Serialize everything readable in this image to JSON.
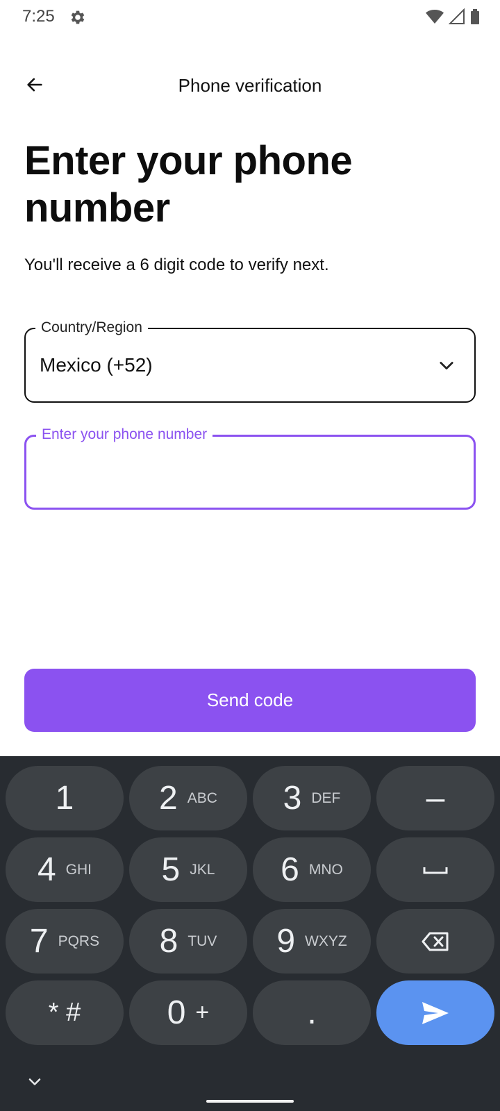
{
  "status_bar": {
    "time": "7:25"
  },
  "app_bar": {
    "title": "Phone verification"
  },
  "content": {
    "heading": "Enter your phone number",
    "subtitle": "You'll receive a 6 digit code to verify next."
  },
  "country_field": {
    "label": "Country/Region",
    "value": "Mexico (+52)"
  },
  "phone_field": {
    "label": "Enter your phone number",
    "value": ""
  },
  "send_button": {
    "label": "Send code"
  },
  "keyboard": {
    "keys": [
      {
        "main": "1",
        "sub": ""
      },
      {
        "main": "2",
        "sub": "ABC"
      },
      {
        "main": "3",
        "sub": "DEF"
      },
      {
        "main": "–",
        "sub": ""
      },
      {
        "main": "4",
        "sub": "GHI"
      },
      {
        "main": "5",
        "sub": "JKL"
      },
      {
        "main": "6",
        "sub": "MNO"
      },
      {
        "main": "space-icon",
        "sub": ""
      },
      {
        "main": "7",
        "sub": "PQRS"
      },
      {
        "main": "8",
        "sub": "TUV"
      },
      {
        "main": "9",
        "sub": "WXYZ"
      },
      {
        "main": "backspace-icon",
        "sub": ""
      },
      {
        "main": "* #",
        "sub": ""
      },
      {
        "main": "0",
        "sub": "+"
      },
      {
        "main": ".",
        "sub": ""
      },
      {
        "main": "send-icon",
        "sub": ""
      }
    ]
  },
  "colors": {
    "accent": "#8b52f0",
    "keyboard_bg": "#282c31",
    "key_bg": "#3d4145",
    "action_key": "#5b93f0"
  }
}
